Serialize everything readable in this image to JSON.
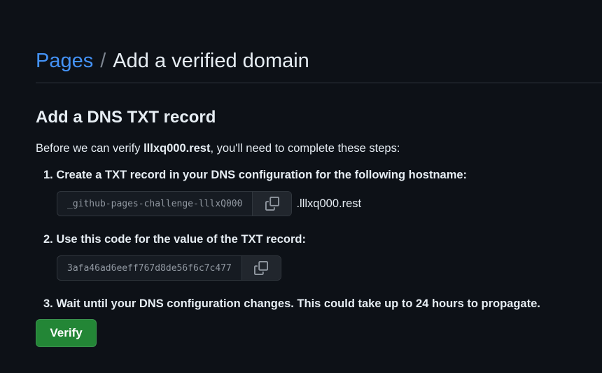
{
  "breadcrumb": {
    "parent": "Pages",
    "separator": "/",
    "current": "Add a verified domain"
  },
  "section": {
    "title": "Add a DNS TXT record"
  },
  "intro": {
    "before": "Before we can verify ",
    "domain": "lllxq000.rest",
    "after": ", you'll need to complete these steps:"
  },
  "steps": [
    {
      "text": "1. Create a TXT record in your DNS configuration for the following hostname:",
      "code": "_github-pages-challenge-lllxQ000",
      "suffix": ".lllxq000.rest",
      "copy_icon": "copy-icon"
    },
    {
      "text": "2. Use this code for the value of the TXT record:",
      "code": "3afa46ad6eeff767d8de56f6c7c477",
      "copy_icon": "copy-icon"
    },
    {
      "text": "3. Wait until your DNS configuration changes. This could take up to 24 hours to propagate."
    }
  ],
  "actions": {
    "verify_label": "Verify"
  },
  "colors": {
    "background": "#0d1117",
    "link": "#4493f8",
    "primary_button": "#238636",
    "border": "#30363d"
  }
}
